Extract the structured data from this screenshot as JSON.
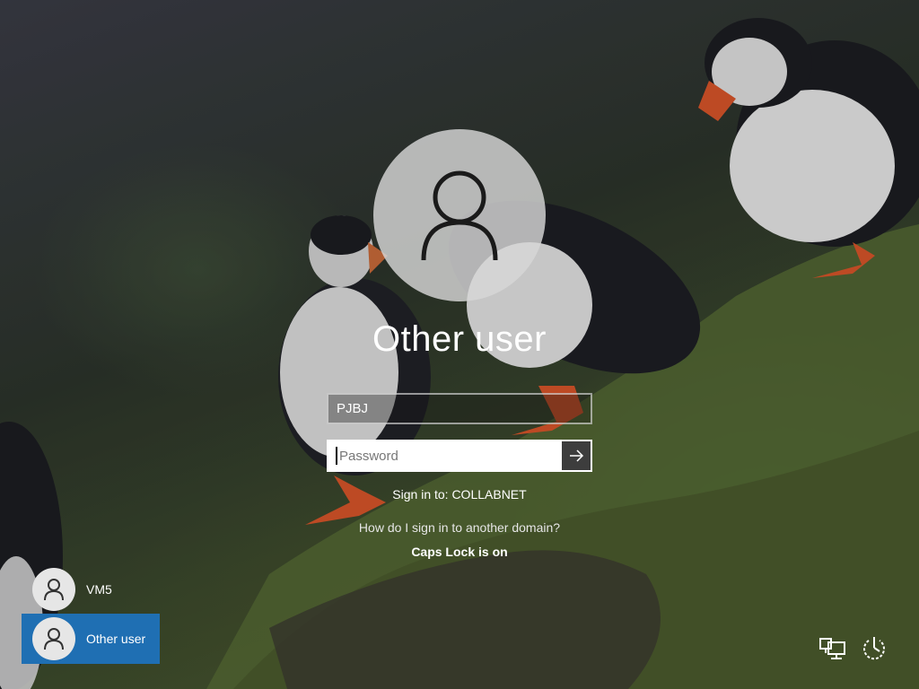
{
  "login": {
    "user_title": "Other user",
    "username_value": "PJBJ",
    "password_placeholder": "Password",
    "sign_in_to": "Sign in to: COLLABNET",
    "other_domain_link": "How do I sign in to another domain?",
    "caps_lock_warning": "Caps Lock is on"
  },
  "users": [
    {
      "name": "VM5",
      "selected": false,
      "icon": "user-icon"
    },
    {
      "name": "Other user",
      "selected": true,
      "icon": "user-icon"
    }
  ],
  "corner_icons": [
    {
      "name": "network-icon"
    },
    {
      "name": "power-icon"
    }
  ],
  "colors": {
    "selected_user_bg": "#1f6fb3",
    "submit_button_bg": "#3d3d3d"
  }
}
